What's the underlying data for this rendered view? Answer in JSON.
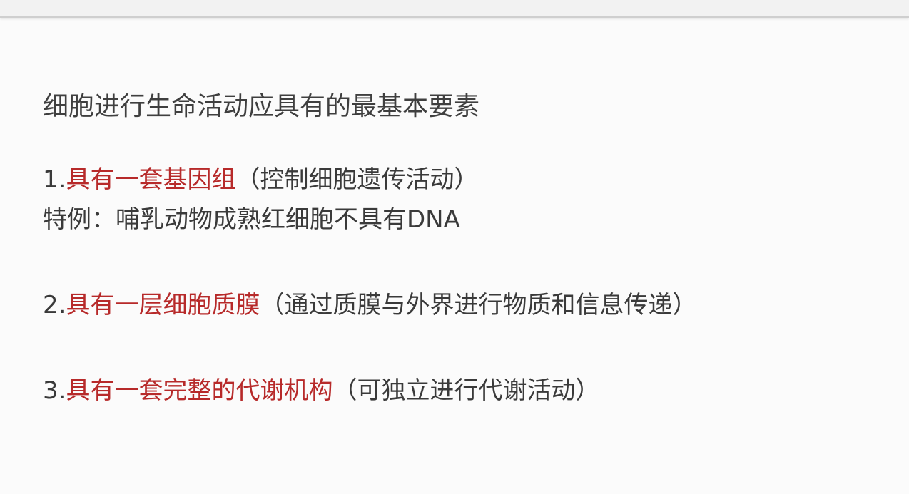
{
  "title": "细胞进行生命活动应具有的最基本要素",
  "items": [
    {
      "number": "1.",
      "key": "具有一套基因组",
      "note": "（控制细胞遗传活动）",
      "extra": "特例：哺乳动物成熟红细胞不具有DNA"
    },
    {
      "number": "2.",
      "key": "具有一层细胞质膜",
      "note": "（通过质膜与外界进行物质和信息传递）"
    },
    {
      "number": "3.",
      "key": "具有一套完整的代谢机构",
      "note": "（可独立进行代谢活动）"
    }
  ],
  "colors": {
    "text": "#3a3a3a",
    "highlight": "#b72a2a",
    "background": "#fbfbfb"
  }
}
